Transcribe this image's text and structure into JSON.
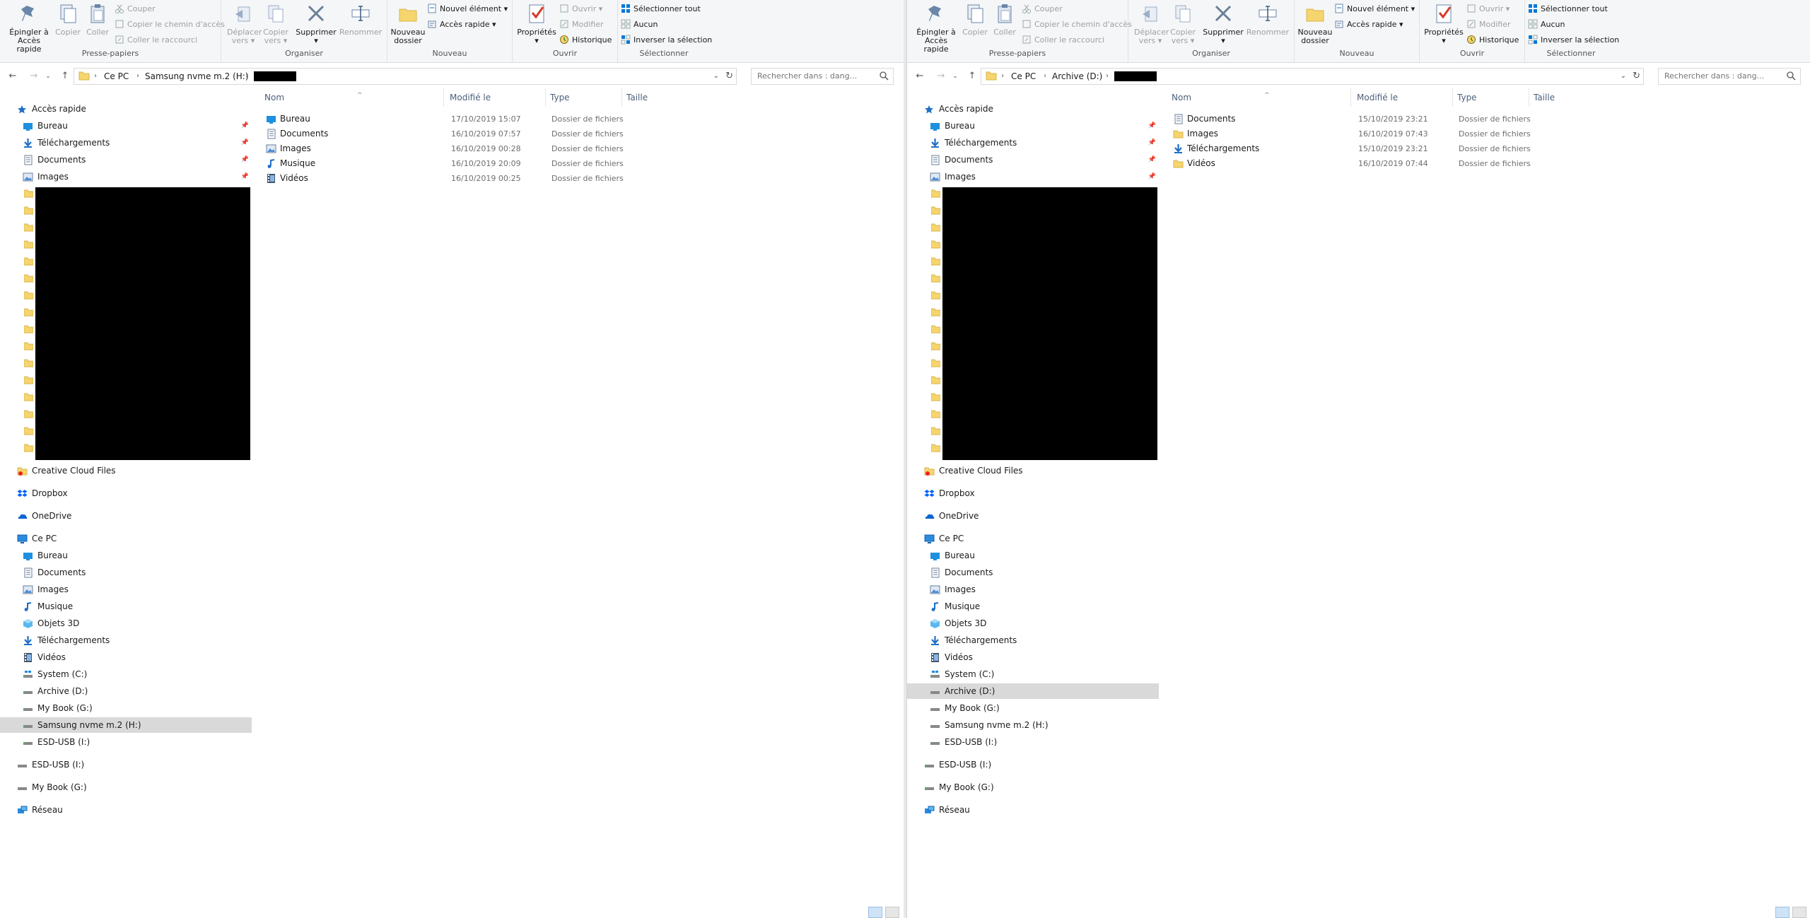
{
  "ribbon": {
    "pin_line1": "Épingler à",
    "pin_line2": "Accès rapide",
    "copy": "Copier",
    "paste": "Coller",
    "cut": "Couper",
    "copy_path": "Copier le chemin d'accès",
    "paste_shortcut": "Coller le raccourci",
    "group_clipboard": "Presse-papiers",
    "move_line1": "Déplacer",
    "move_line2": "vers",
    "copyto_line1": "Copier",
    "copyto_line2": "vers",
    "delete": "Supprimer",
    "rename": "Renommer",
    "group_organize": "Organiser",
    "new_folder_line1": "Nouveau",
    "new_folder_line2": "dossier",
    "new_item": "Nouvel élément",
    "easy_access": "Accès rapide",
    "group_new": "Nouveau",
    "properties": "Propriétés",
    "open": "Ouvrir",
    "edit": "Modifier",
    "history": "Historique",
    "group_open": "Ouvrir",
    "select_all": "Sélectionner tout",
    "select_none": "Aucun",
    "invert_selection": "Inverser la sélection",
    "group_select": "Sélectionner"
  },
  "columns": {
    "name": "Nom",
    "modified": "Modifié le",
    "type": "Type",
    "size": "Taille"
  },
  "search_placeholder": "Rechercher dans : dang...",
  "nav_common": {
    "quick_access": "Accès rapide",
    "bureau": "Bureau",
    "telechargements": "Téléchargements",
    "documents": "Documents",
    "images": "Images",
    "creative_cloud": "Creative Cloud Files",
    "dropbox": "Dropbox",
    "onedrive": "OneDrive",
    "ce_pc": "Ce PC",
    "musique": "Musique",
    "objets3d": "Objets 3D",
    "videos": "Vidéos",
    "system": "System (C:)",
    "archive": "Archive (D:)",
    "mybook": "My Book (G:)",
    "samsung": "Samsung nvme m.2 (H:)",
    "esdusb": "ESD-USB (I:)",
    "reseau": "Réseau"
  },
  "left": {
    "crumbs": [
      "Ce PC",
      "Samsung nvme m.2 (H:)"
    ],
    "files": [
      {
        "name": "Bureau",
        "modified": "17/10/2019 15:07",
        "type": "Dossier de fichiers",
        "icon": "desktop-folder-icon"
      },
      {
        "name": "Documents",
        "modified": "16/10/2019 07:57",
        "type": "Dossier de fichiers",
        "icon": "documents-folder-icon"
      },
      {
        "name": "Images",
        "modified": "16/10/2019 00:28",
        "type": "Dossier de fichiers",
        "icon": "images-folder-icon"
      },
      {
        "name": "Musique",
        "modified": "16/10/2019 20:09",
        "type": "Dossier de fichiers",
        "icon": "music-folder-icon"
      },
      {
        "name": "Vidéos",
        "modified": "16/10/2019 00:25",
        "type": "Dossier de fichiers",
        "icon": "videos-folder-icon"
      }
    ]
  },
  "right": {
    "crumbs": [
      "Ce PC",
      "Archive (D:)"
    ],
    "files": [
      {
        "name": "Documents",
        "modified": "15/10/2019 23:21",
        "type": "Dossier de fichiers",
        "icon": "documents-folder-icon"
      },
      {
        "name": "Images",
        "modified": "16/10/2019 07:43",
        "type": "Dossier de fichiers",
        "icon": "folder-icon"
      },
      {
        "name": "Téléchargements",
        "modified": "15/10/2019 23:21",
        "type": "Dossier de fichiers",
        "icon": "downloads-folder-icon"
      },
      {
        "name": "Vidéos",
        "modified": "16/10/2019 07:44",
        "type": "Dossier de fichiers",
        "icon": "folder-icon"
      }
    ]
  },
  "colors": {
    "folder": "#f6d56e",
    "selected": "#d9d9d9",
    "accent": "#0078d7",
    "header_text": "#4c607a"
  }
}
